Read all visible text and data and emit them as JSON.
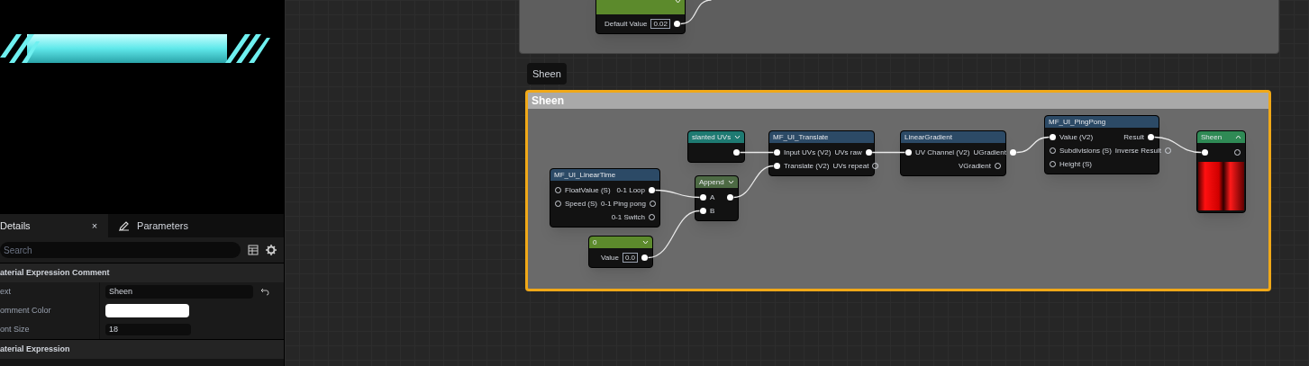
{
  "details_panel": {
    "tabs": [
      {
        "label": "Details",
        "selected": true,
        "close": "×"
      },
      {
        "label": "Parameters",
        "selected": false
      }
    ],
    "search": {
      "placeholder": "Search"
    },
    "sections": [
      {
        "title": "aterial Expression Comment",
        "rows": [
          {
            "kind": "text",
            "label": "ext",
            "value": "Sheen"
          },
          {
            "kind": "color",
            "label": "omment Color",
            "color": "#ffffff"
          },
          {
            "kind": "number",
            "label": "ont Size",
            "value": "18"
          }
        ]
      },
      {
        "title": "aterial Expression"
      }
    ]
  },
  "graph": {
    "comments": [
      {
        "kind": "plain"
      },
      {
        "kind": "titled",
        "title": "Sheen",
        "bubble": "Sheen"
      }
    ],
    "nodes": [
      {
        "kind": "param",
        "color": "#5c8a2c",
        "field_label": "Default Value",
        "field_value": "0.02",
        "outputs": [
          {
            "connected": true
          }
        ]
      },
      {
        "kind": "param",
        "title": "slanted UVs",
        "color": "#1e7a72",
        "outputs": [
          {
            "connected": true
          }
        ]
      },
      {
        "kind": "function",
        "title": "MF_UI_LinearTime",
        "color": "#2c4a66",
        "inputs": [
          {
            "label": "FloatValue (S)",
            "connected": false
          },
          {
            "label": "Speed (S)",
            "connected": false
          }
        ],
        "outputs": [
          {
            "label": "0-1 Loop",
            "connected": true
          },
          {
            "label": "0-1 Ping pong",
            "connected": false
          },
          {
            "label": "0-1 Switch",
            "connected": false
          }
        ]
      },
      {
        "kind": "function",
        "title": "Append",
        "color": "#4d6a44",
        "inputs": [
          {
            "label": "A",
            "connected": true
          },
          {
            "label": "B",
            "connected": true
          }
        ],
        "outputs": [
          {
            "connected": true
          }
        ]
      },
      {
        "kind": "param",
        "title": "0",
        "color": "#5c8a2c",
        "field_label": "Value",
        "field_value": "0.0",
        "outputs": [
          {
            "connected": true
          }
        ]
      },
      {
        "kind": "function",
        "title": "MF_UI_Translate",
        "color": "#2c4a66",
        "inputs": [
          {
            "label": "Input UVs (V2)",
            "connected": true
          },
          {
            "label": "Translate (V2)",
            "connected": true
          }
        ],
        "outputs": [
          {
            "label": "UVs raw",
            "connected": true
          },
          {
            "label": "UVs repeat",
            "connected": false
          }
        ]
      },
      {
        "kind": "function",
        "title": "LinearGradient",
        "color": "#2c4a66",
        "inputs": [
          {
            "label": "UV Channel (V2)",
            "connected": true
          }
        ],
        "outputs": [
          {
            "label": "UGradient",
            "connected": true
          },
          {
            "label": "VGradient",
            "connected": false
          }
        ]
      },
      {
        "kind": "function",
        "title": "MF_UI_PingPong",
        "color": "#2c4a66",
        "inputs": [
          {
            "label": "Value (V2)",
            "connected": true
          },
          {
            "label": "Subdivisions (S)",
            "connected": false
          },
          {
            "label": "Height (S)",
            "connected": false
          }
        ],
        "outputs": [
          {
            "label": "Result",
            "connected": true
          },
          {
            "label": "Inverse Result",
            "connected": false
          }
        ]
      },
      {
        "kind": "output",
        "title": "Sheen",
        "color": "#2f8a55",
        "inputs": [
          {
            "connected": true
          }
        ],
        "outputs": [
          {
            "connected": false
          }
        ]
      }
    ]
  }
}
